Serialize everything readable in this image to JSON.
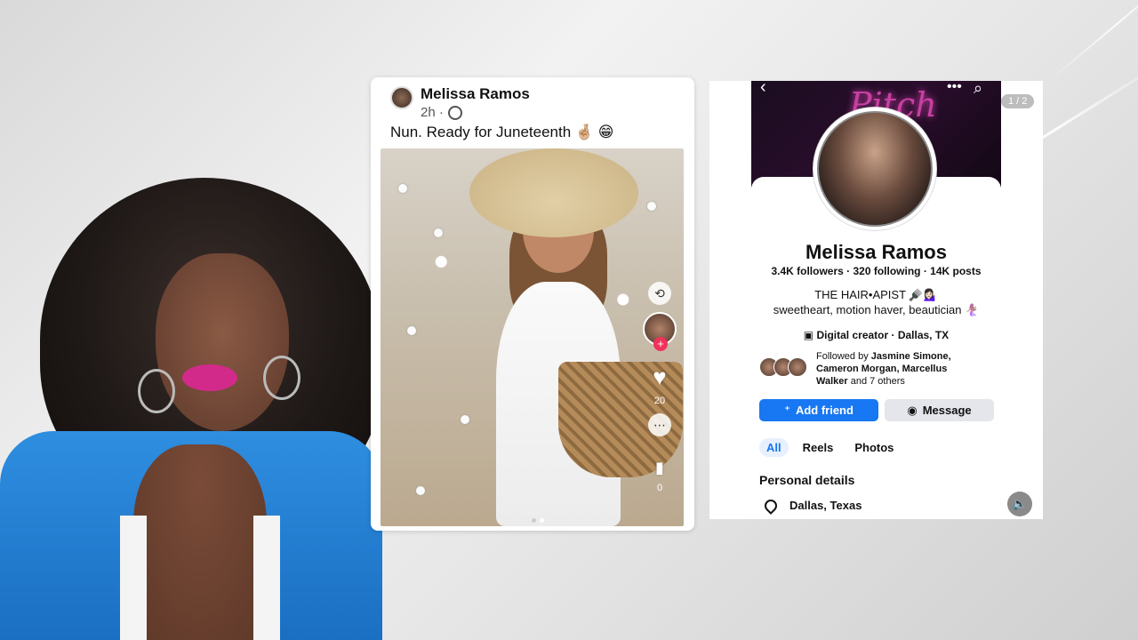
{
  "post": {
    "author": "Melissa Ramos",
    "time": "2h ·",
    "text": "Nun. Ready for Juneteenth 🤞🏼 😁",
    "like_count": "20",
    "save_count": "0"
  },
  "profile": {
    "pager": "1 / 2",
    "cover_text": "Pitch Bad",
    "name": "Melissa Ramos",
    "stats": "3.4K followers · 320 following · 14K posts",
    "bio_line1": "THE HAIR•APIST 🪮💁🏻‍♀️",
    "bio_line2": "sweetheart, motion haver, beautician 🧜🏽‍♀️",
    "meta": "Digital creator · Dallas, TX",
    "followed_prefix": "Followed by ",
    "followed_names": "Jasmine Simone, Cameron Morgan, Marcellus Walker",
    "followed_suffix": " and 7 others",
    "add_friend": "Add friend",
    "message": "Message",
    "tabs": [
      "All",
      "Reels",
      "Photos"
    ],
    "section_title": "Personal details",
    "location": "Dallas, Texas"
  },
  "icons": [
    "globe-icon",
    "back-chevron-icon",
    "more-icon",
    "search-icon",
    "heart-icon",
    "comment-icon",
    "bookmark-icon",
    "plus-icon",
    "location-pin-icon",
    "speaker-icon",
    "add-friend-icon",
    "messenger-icon"
  ]
}
